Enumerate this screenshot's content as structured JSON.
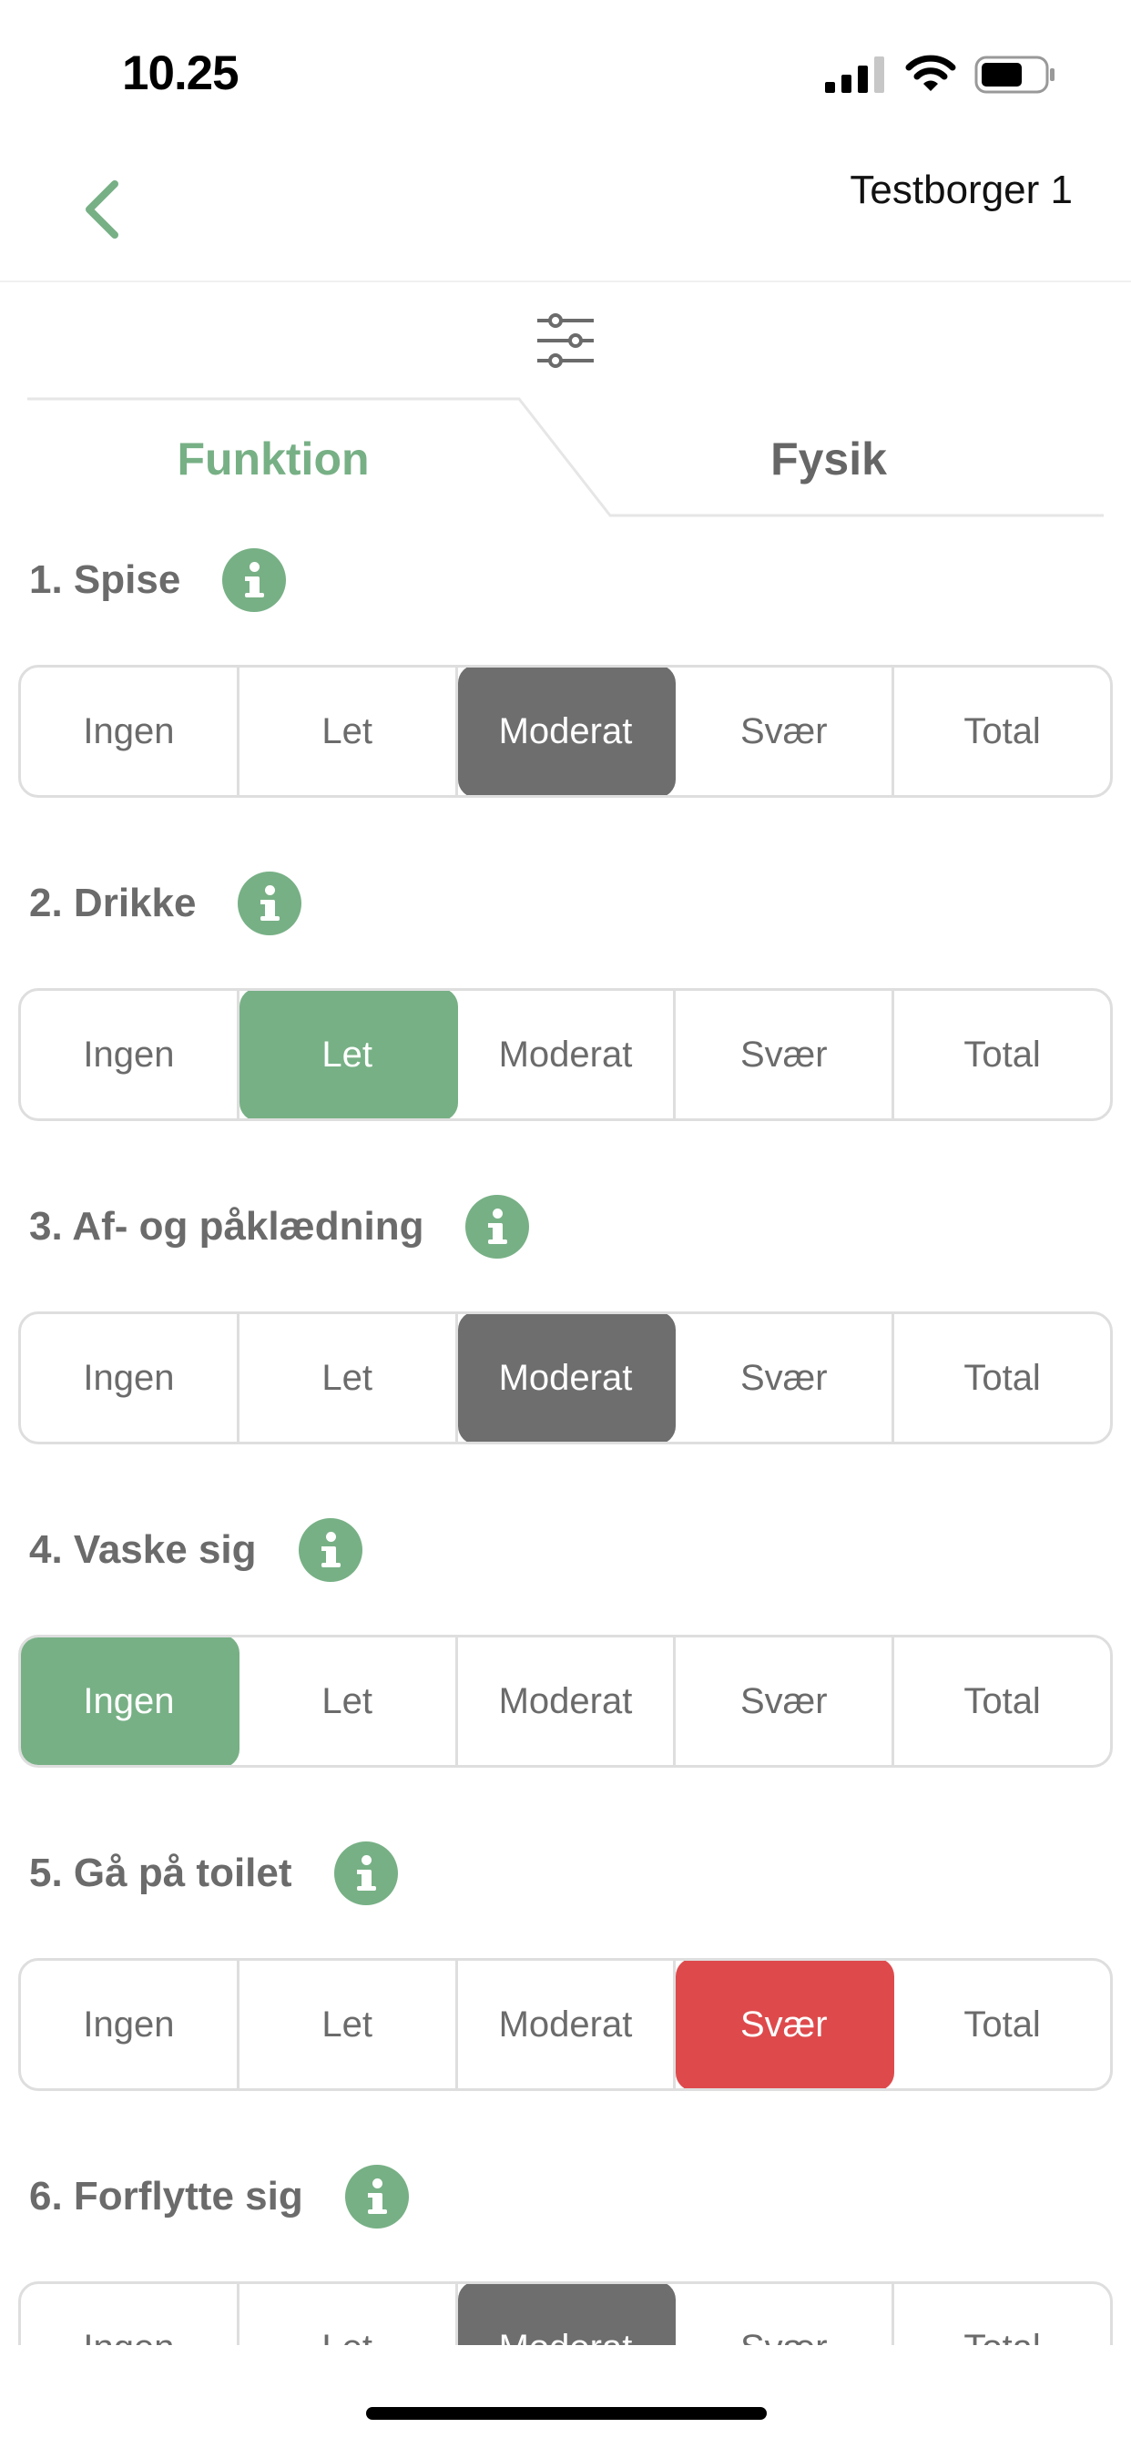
{
  "status_bar": {
    "time": "10.25"
  },
  "nav": {
    "back_icon": "chevron-left-icon",
    "title": "Testborger 1"
  },
  "filter_icon": "sliders-icon",
  "tabs": [
    {
      "label": "Funktion",
      "active": true
    },
    {
      "label": "Fysik",
      "active": false
    }
  ],
  "colors": {
    "accent": "#77b085",
    "selected_neutral": "#6e6e6e",
    "selected_severe": "#de4a4c",
    "text": "#6b6b6b"
  },
  "options": [
    "Ingen",
    "Let",
    "Moderat",
    "Svær",
    "Total"
  ],
  "sections": [
    {
      "title": "1. Spise",
      "selected": "Moderat",
      "tone": "gray"
    },
    {
      "title": "2. Drikke",
      "selected": "Let",
      "tone": "green"
    },
    {
      "title": "3. Af- og påklædning",
      "selected": "Moderat",
      "tone": "gray"
    },
    {
      "title": "4. Vaske sig",
      "selected": "Ingen",
      "tone": "green"
    },
    {
      "title": "5. Gå på toilet",
      "selected": "Svær",
      "tone": "red"
    },
    {
      "title": "6. Forflytte sig",
      "selected": "Moderat",
      "tone": "gray"
    }
  ]
}
